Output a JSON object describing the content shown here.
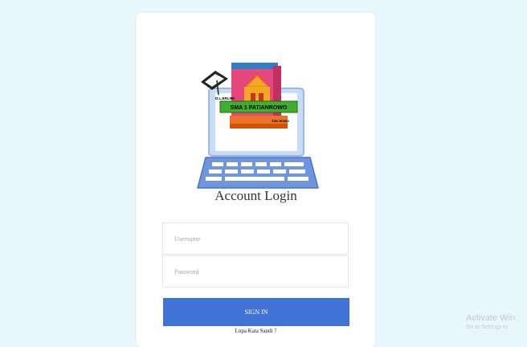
{
  "logo": {
    "banner_text": "SMA 1 PATIANROWO",
    "top_text": "D.L.ERLIMI",
    "bottom_text": "TUK ROWO"
  },
  "login": {
    "title": "Account Login",
    "username_placeholder": "Username",
    "password_placeholder": "Password",
    "signin_label": "SIGN IN",
    "forgot_label": "Lupa Kata Sandi ?"
  },
  "watermark": {
    "line1": "Activate Win",
    "line2": "Go to Settings to"
  },
  "colors": {
    "background": "#e8f7fc",
    "card": "#ffffff",
    "accent": "#4173d6"
  }
}
